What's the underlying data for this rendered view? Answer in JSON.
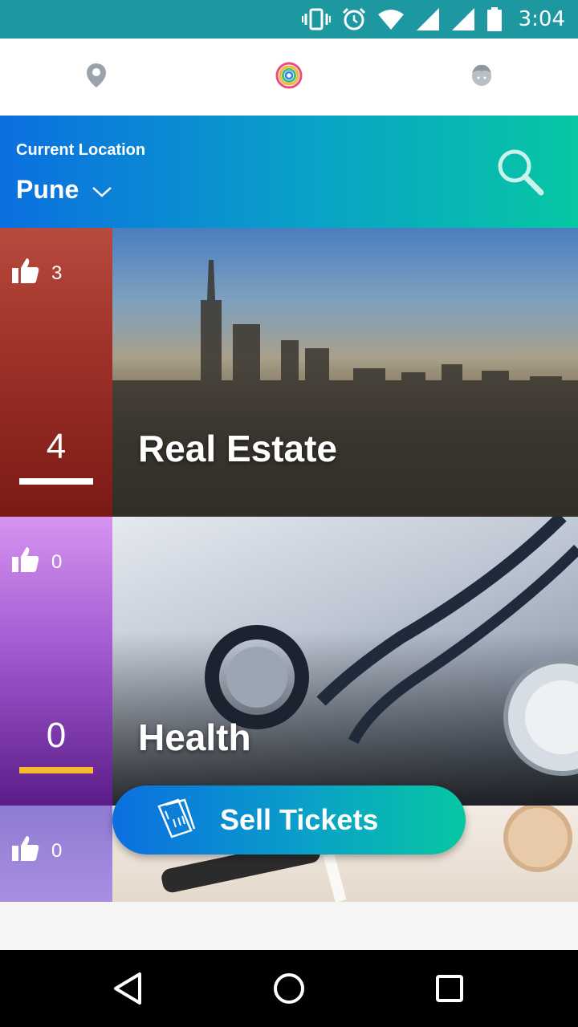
{
  "status_bar": {
    "time": "3:04",
    "icons": [
      "vibrate-icon",
      "alarm-icon",
      "wifi-icon",
      "signal-icon",
      "signal-icon",
      "battery-icon"
    ]
  },
  "top_nav": {
    "items": [
      {
        "name": "location-pin-icon"
      },
      {
        "name": "circles-logo-icon"
      },
      {
        "name": "profile-face-icon"
      }
    ]
  },
  "location": {
    "label": "Current Location",
    "city": "Pune"
  },
  "categories": [
    {
      "likes": "3",
      "count": "4",
      "title": "Real Estate",
      "underline_color": "#ffffff"
    },
    {
      "likes": "0",
      "count": "0",
      "title": "Health",
      "underline_color": "#f5b82e"
    },
    {
      "likes": "0",
      "count": "",
      "title": ""
    }
  ],
  "sell_button": {
    "label": "Sell Tickets"
  },
  "colors": {
    "status_bar": "#1e98a0",
    "gradient_start": "#0b6fe0",
    "gradient_end": "#06c7a3"
  }
}
